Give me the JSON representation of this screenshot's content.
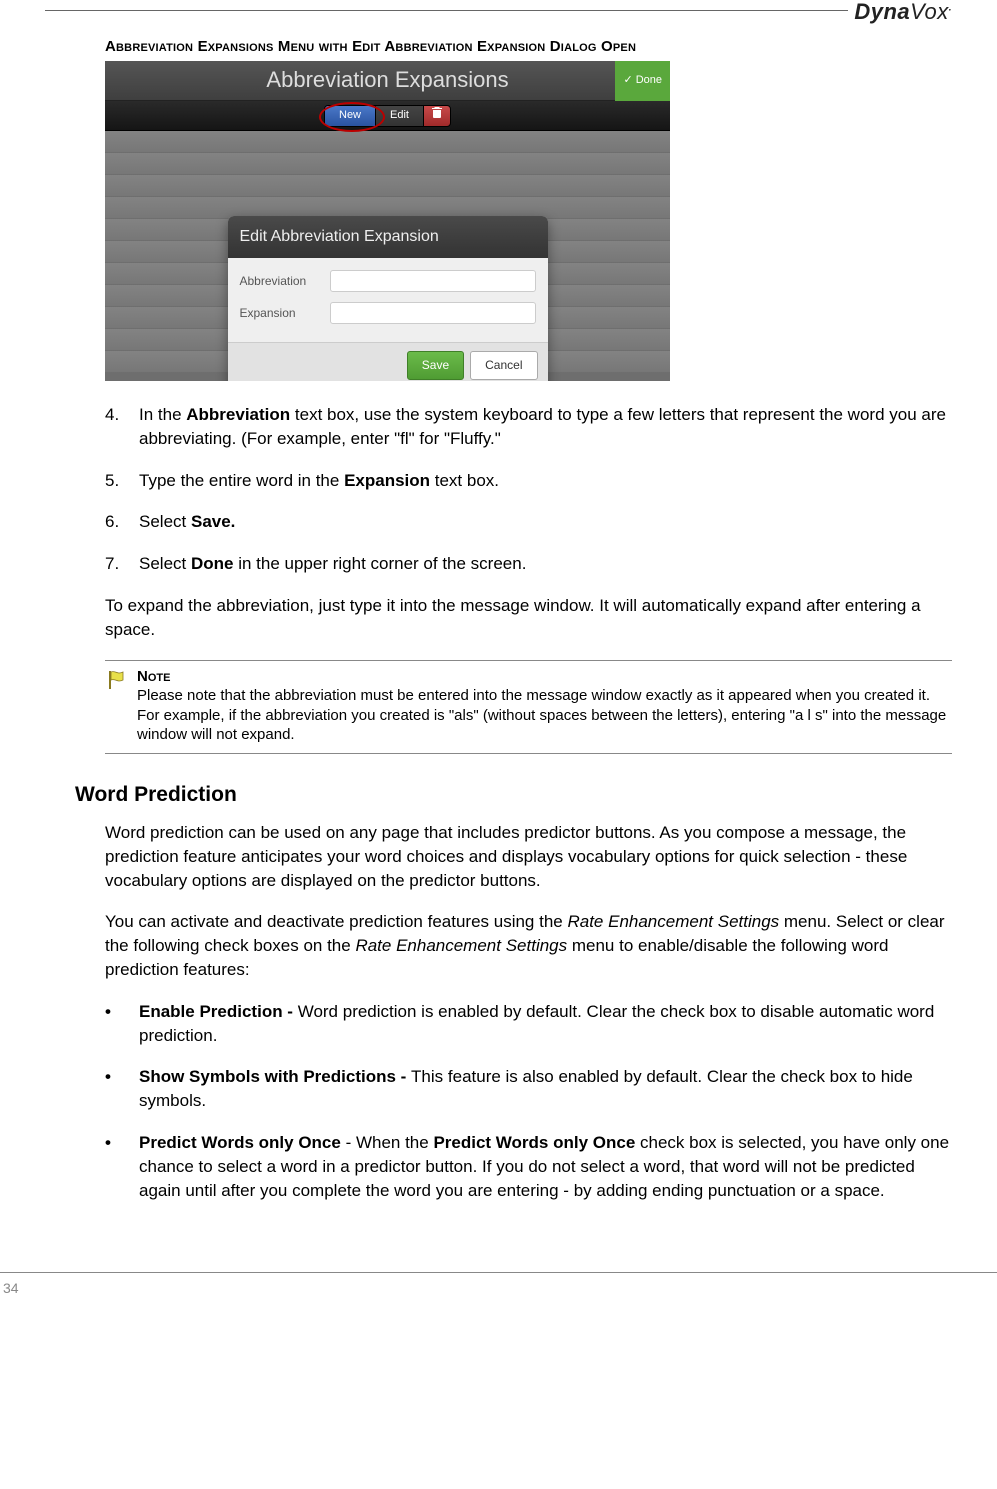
{
  "brand": "DynaVox",
  "figure_caption": "Abbreviation Expansions Menu with Edit Abbreviation Expansion Dialog Open",
  "screenshot": {
    "header_title": "Abbreviation Expansions",
    "done_label": "Done",
    "toolbar": {
      "new": "New",
      "edit": "Edit"
    },
    "modal": {
      "title": "Edit Abbreviation Expansion",
      "abbrev_label": "Abbreviation",
      "expansion_label": "Expansion",
      "save": "Save",
      "cancel": "Cancel"
    }
  },
  "steps": [
    {
      "n": "4.",
      "pre": "In the ",
      "bold1": "Abbreviation",
      "post": " text box, use the system keyboard to type a few letters that represent the word you are abbreviating. (For example, enter \"fl\" for \"Fluffy.\""
    },
    {
      "n": "5.",
      "pre": "Type the entire word in the ",
      "bold1": "Expansion",
      "post": " text box."
    },
    {
      "n": "6.",
      "pre": "Select ",
      "bold1": "Save.",
      "post": ""
    },
    {
      "n": "7.",
      "pre": "Select ",
      "bold1": "Done",
      "post": " in the upper right corner of the screen."
    }
  ],
  "expand_para": "To expand the abbreviation, just type it into the message window. It will automatically expand after entering a space.",
  "note": {
    "label": "Note",
    "text": "Please note that the abbreviation must be entered into the message window exactly as it appeared when you created it. For example, if the abbreviation you created is \"als\" (without spaces between the letters), entering \"a l s\" into the message window will not expand."
  },
  "section_heading": "Word Prediction",
  "wp_para1": "Word prediction can be used on any page that includes predictor buttons. As you compose a message, the prediction feature anticipates your word choices and displays vocabulary options for quick selection - these vocabulary options are displayed on the predictor buttons.",
  "wp_para2_a": "You can activate and deactivate prediction features using the ",
  "wp_para2_i1": "Rate Enhancement Settings",
  "wp_para2_b": " menu. Select or clear the following check boxes on the ",
  "wp_para2_i2": "Rate Enhancement Settings",
  "wp_para2_c": " menu to enable/disable the following word prediction features:",
  "bullets": [
    {
      "bold": "Enable Prediction - ",
      "text": "Word prediction is enabled by default. Clear the check box to disable automatic word prediction."
    },
    {
      "bold": "Show Symbols with Predictions - ",
      "text": "This feature is also enabled by default. Clear the check box to hide symbols."
    }
  ],
  "bullet3": {
    "b1": "Predict Words only Once",
    "mid": " - When the ",
    "b2": "Predict Words only Once",
    "rest": " check box is selected, you have only one chance to select a word in a predictor button. If you do not select a word, that word will not be predicted again until after you complete the word you are entering - by adding ending punctuation or a space."
  },
  "page_number": "34"
}
